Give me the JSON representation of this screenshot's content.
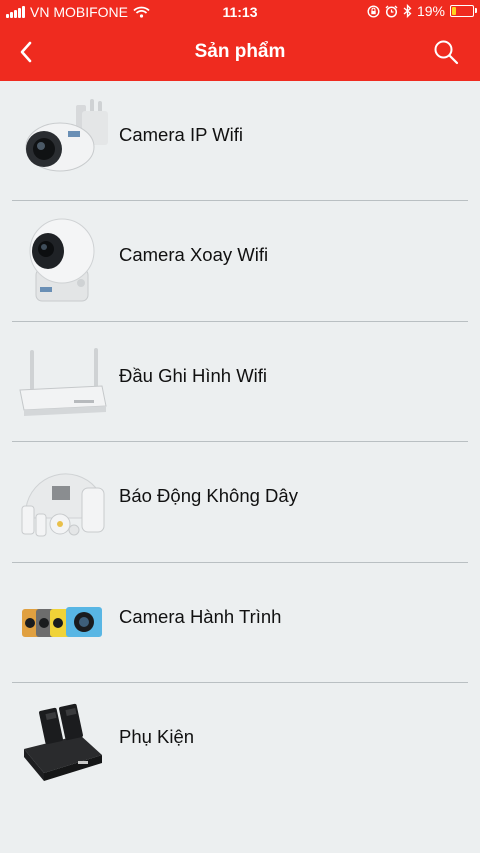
{
  "status_bar": {
    "carrier": "VN MOBIFONE",
    "time": "11:13",
    "battery_percent": "19%",
    "battery_level": 0.19,
    "icons": [
      "signal-icon",
      "wifi-icon",
      "rotation-lock-icon",
      "alarm-icon",
      "bluetooth-icon",
      "battery-icon"
    ]
  },
  "header": {
    "title": "Sản phẩm",
    "back_icon": "chevron-left-icon",
    "search_icon": "search-icon",
    "background": "#ef2b1f"
  },
  "products": [
    {
      "label": "Camera IP Wifi",
      "icon": "bullet-camera-image"
    },
    {
      "label": "Camera Xoay Wifi",
      "icon": "dome-camera-image"
    },
    {
      "label": "Đầu Ghi Hình Wifi",
      "icon": "nvr-recorder-image"
    },
    {
      "label": "Báo Động Không Dây",
      "icon": "alarm-kit-image"
    },
    {
      "label": "Camera Hành Trình",
      "icon": "action-camera-image"
    },
    {
      "label": "Phụ Kiện",
      "icon": "battery-charger-image"
    }
  ]
}
